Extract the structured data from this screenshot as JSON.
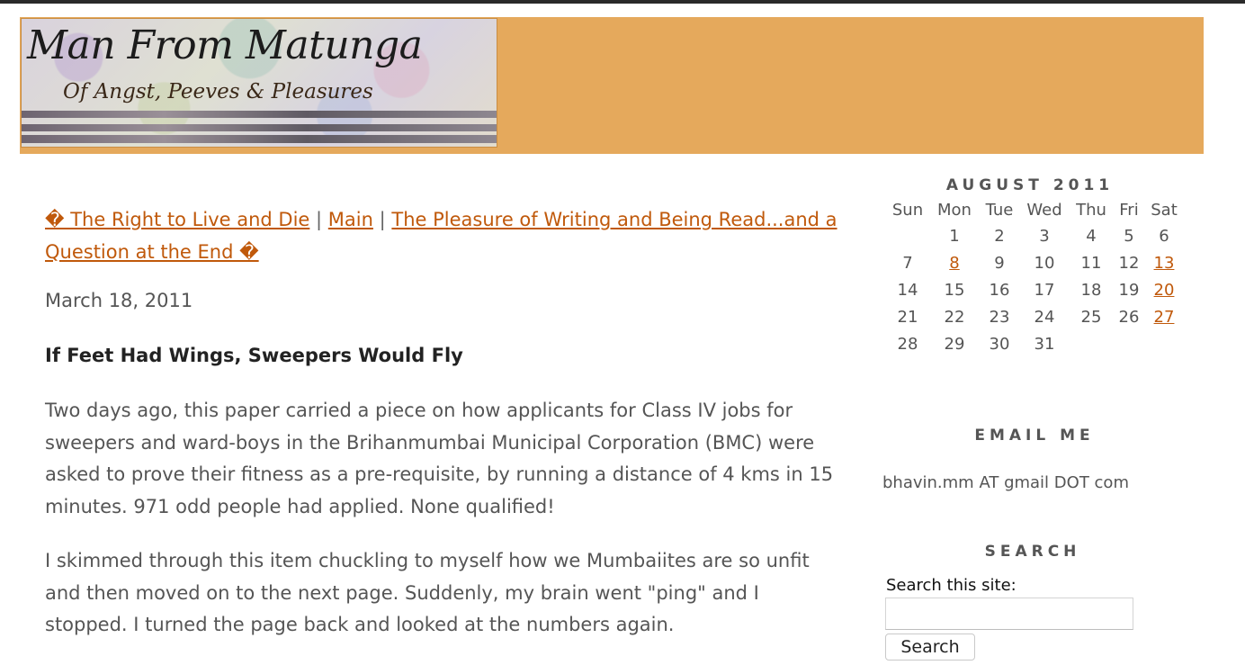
{
  "header": {
    "title": "Man From Matunga",
    "tagline": "Of Angst, Peeves & Pleasures"
  },
  "post_nav": {
    "prev_label": "� The Right to Live and Die",
    "separator": "|",
    "main_label": "Main",
    "next_label": "The Pleasure of Writing and Being Read...and a Question at the End �"
  },
  "post": {
    "date": "March 18, 2011",
    "title": "If Feet Had Wings, Sweepers Would Fly",
    "paragraphs": [
      "Two days ago, this paper carried a piece on how applicants for Class IV jobs for sweepers and ward-boys in the Brihanmumbai Municipal Corporation (BMC) were asked to prove their fitness as a pre-requisite, by running a distance of 4 kms in 15 minutes. 971 odd people had applied. None qualified!",
      "I skimmed through this item chuckling to myself how we Mumbaiites are so unfit and then moved on to the next page. Suddenly, my brain went \"ping\" and I stopped. I turned the page back and looked at the numbers again."
    ]
  },
  "calendar": {
    "caption": "AUGUST 2011",
    "weekdays": [
      "Sun",
      "Mon",
      "Tue",
      "Wed",
      "Thu",
      "Fri",
      "Sat"
    ],
    "weeks": [
      [
        "",
        "1",
        "2",
        "3",
        "4",
        "5",
        "6"
      ],
      [
        "7",
        "8",
        "9",
        "10",
        "11",
        "12",
        "13"
      ],
      [
        "14",
        "15",
        "16",
        "17",
        "18",
        "19",
        "20"
      ],
      [
        "21",
        "22",
        "23",
        "24",
        "25",
        "26",
        "27"
      ],
      [
        "28",
        "29",
        "30",
        "31",
        "",
        "",
        ""
      ]
    ],
    "linked_days": [
      "8",
      "13",
      "20",
      "27"
    ]
  },
  "email": {
    "heading": "EMAIL ME",
    "address": "bhavin.mm AT gmail DOT com"
  },
  "search": {
    "heading": "SEARCH",
    "label": "Search this site:",
    "input_value": "",
    "button_label": "Search"
  },
  "colors": {
    "banner": "#e5a95c",
    "link": "#c0590b",
    "text": "#555555"
  }
}
